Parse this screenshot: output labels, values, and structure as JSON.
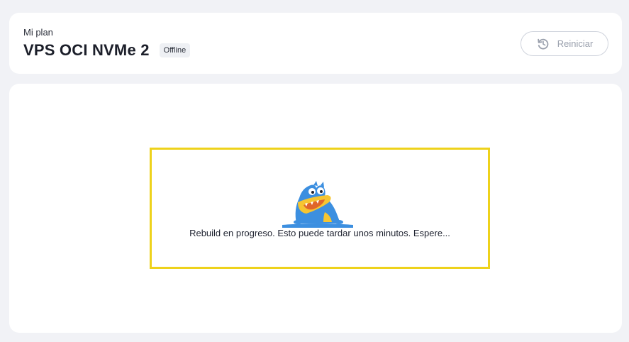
{
  "header": {
    "subtitle": "Mi plan",
    "title": "VPS OCI NVMe 2",
    "status": "Offline",
    "restart_label": "Reiniciar",
    "restart_icon": "restart-icon"
  },
  "main": {
    "progress_message": "Rebuild en progreso. Esto puede tardar unos minutos. Espere...",
    "mascot_icon": "gator-mascot-icon"
  },
  "colors": {
    "background": "#f1f2f6",
    "card": "#ffffff",
    "highlight_border": "#eed21b",
    "mascot_blue": "#3c8fe0",
    "mascot_yellow": "#f6c531",
    "button_text": "#9aa0ad"
  }
}
